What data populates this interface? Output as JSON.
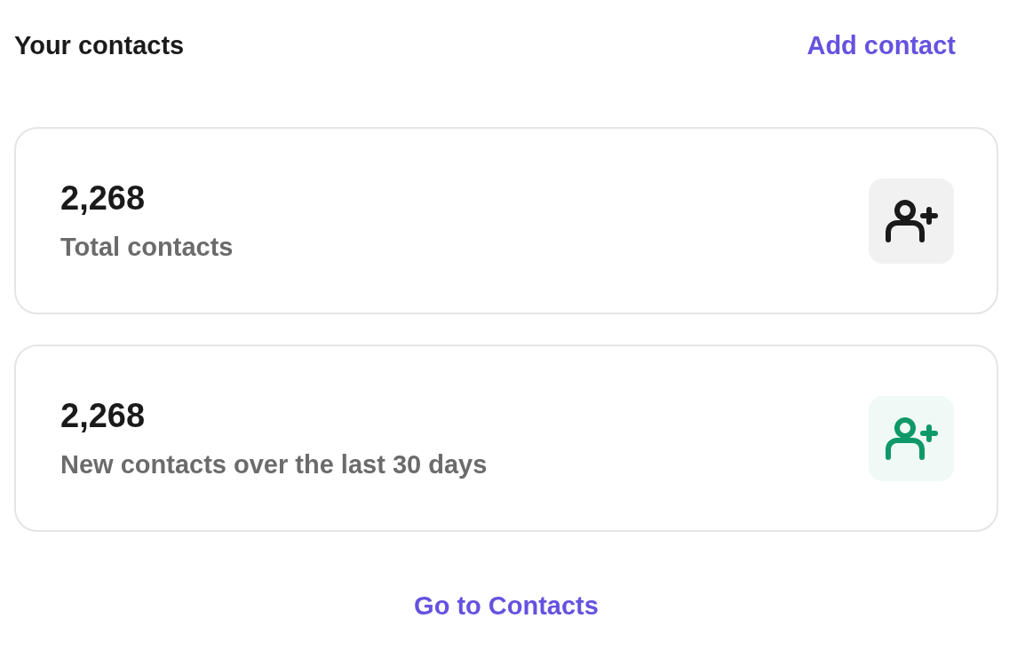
{
  "header": {
    "title": "Your contacts",
    "action": "Add contact"
  },
  "stats": [
    {
      "value": "2,268",
      "label": "Total contacts",
      "color": "#1a1a1a"
    },
    {
      "value": "2,268",
      "label": "New contacts over the last 30 days",
      "color": "#0f9968"
    }
  ],
  "footer_link": "Go to Contacts"
}
